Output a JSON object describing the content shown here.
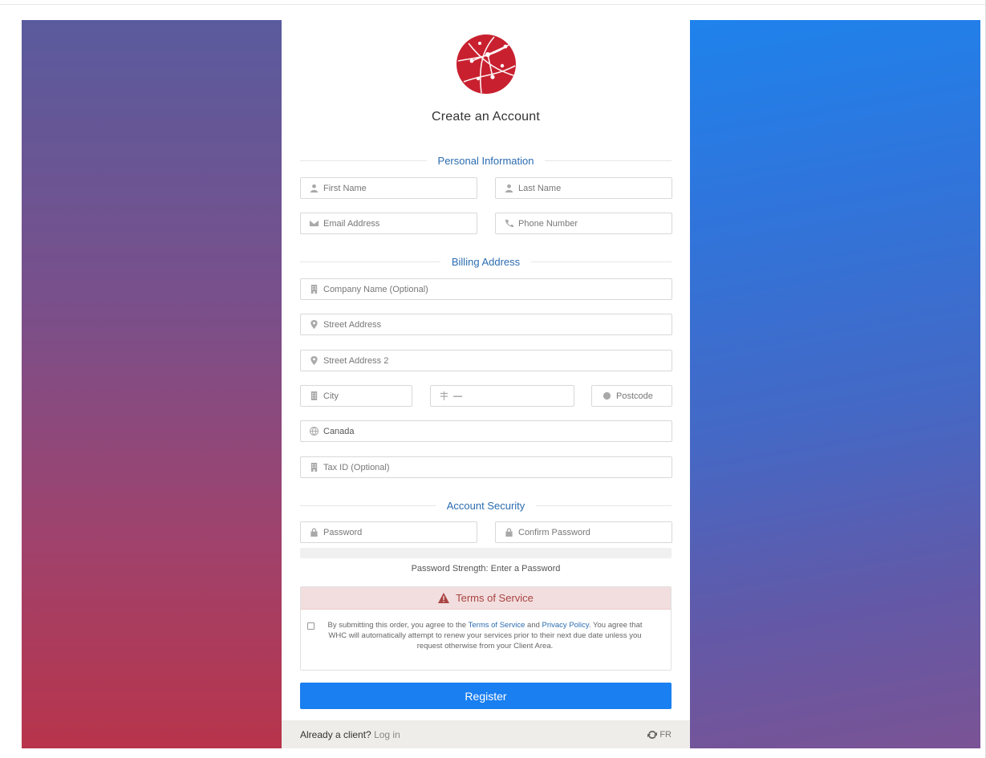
{
  "page": {
    "title": "Create an Account"
  },
  "sections": {
    "personal": "Personal Information",
    "billing": "Billing Address",
    "security": "Account Security"
  },
  "fields": {
    "first_name": "First Name",
    "last_name": "Last Name",
    "email": "Email Address",
    "phone": "Phone Number",
    "company": "Company Name (Optional)",
    "street": "Street Address",
    "street2": "Street Address 2",
    "city": "City",
    "state_value": "—",
    "postcode": "Postcode",
    "country_value": "Canada",
    "tax_id": "Tax ID (Optional)",
    "password": "Password",
    "confirm_password": "Confirm Password"
  },
  "password_strength": "Password Strength: Enter a Password",
  "tos": {
    "heading": "Terms of Service",
    "text_1": "By submitting this order, you agree to the ",
    "link_terms": "Terms of Service",
    "text_2": " and ",
    "link_privacy": "Privacy Policy",
    "text_3": ". You agree that WHC will automatically attempt to renew your services prior to their next due date unless you request otherwise from your Client Area."
  },
  "register_label": "Register",
  "footer": {
    "already_client": "Already a client?",
    "login_link": "Log in",
    "language": "FR"
  },
  "colors": {
    "accent": "#1a7ff0",
    "section_title": "#2b6cb0",
    "logo_red": "#c8202f",
    "tos_bg": "#f2dede"
  }
}
